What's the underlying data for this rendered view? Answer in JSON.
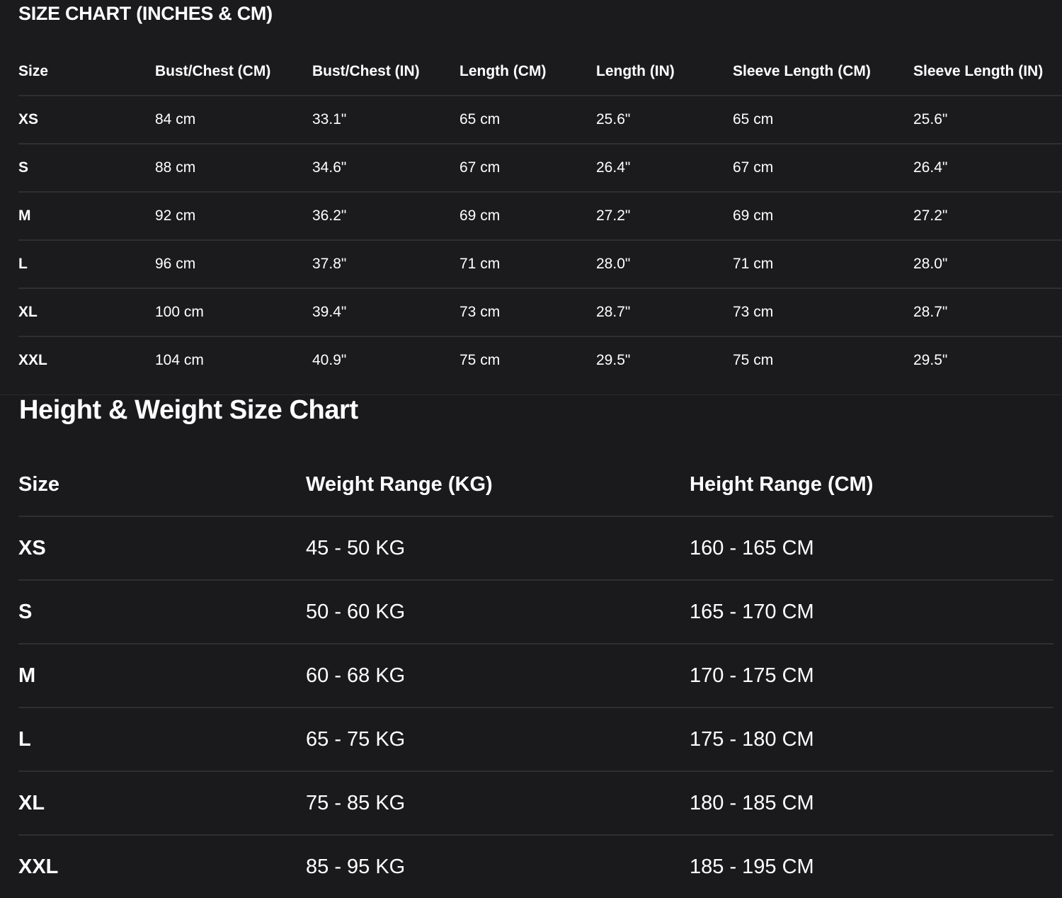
{
  "size_chart": {
    "title": "SIZE CHART (INCHES & CM)",
    "headers": [
      "Size",
      "Bust/Chest (CM)",
      "Bust/Chest (IN)",
      "Length (CM)",
      "Length (IN)",
      "Sleeve Length (CM)",
      "Sleeve Length (IN)"
    ],
    "rows": [
      [
        "XS",
        "84 cm",
        "33.1\"",
        "65 cm",
        "25.6\"",
        "65 cm",
        "25.6\""
      ],
      [
        "S",
        "88 cm",
        "34.6\"",
        "67 cm",
        "26.4\"",
        "67 cm",
        "26.4\""
      ],
      [
        "M",
        "92 cm",
        "36.2\"",
        "69 cm",
        "27.2\"",
        "69 cm",
        "27.2\""
      ],
      [
        "L",
        "96 cm",
        "37.8\"",
        "71 cm",
        "28.0\"",
        "71 cm",
        "28.0\""
      ],
      [
        "XL",
        "100 cm",
        "39.4\"",
        "73 cm",
        "28.7\"",
        "73 cm",
        "28.7\""
      ],
      [
        "XXL",
        "104 cm",
        "40.9\"",
        "75 cm",
        "29.5\"",
        "75 cm",
        "29.5\""
      ]
    ]
  },
  "height_weight_chart": {
    "title": "Height & Weight Size Chart",
    "headers": [
      "Size",
      "Weight Range (KG)",
      "Height Range (CM)"
    ],
    "rows": [
      [
        "XS",
        "45 - 50 KG",
        "160 - 165 CM"
      ],
      [
        "S",
        "50 - 60 KG",
        "165 - 170 CM"
      ],
      [
        "M",
        "60 - 68 KG",
        "170 - 175 CM"
      ],
      [
        "L",
        "65 - 75 KG",
        "175 - 180 CM"
      ],
      [
        "XL",
        "75 - 85 KG",
        "180 - 185 CM"
      ],
      [
        "XXL",
        "85 - 95 KG",
        "185 - 195 CM"
      ]
    ]
  },
  "colors": {
    "background": "#1b1b1d",
    "text": "#ffffff",
    "divider": "#2f2f32"
  }
}
